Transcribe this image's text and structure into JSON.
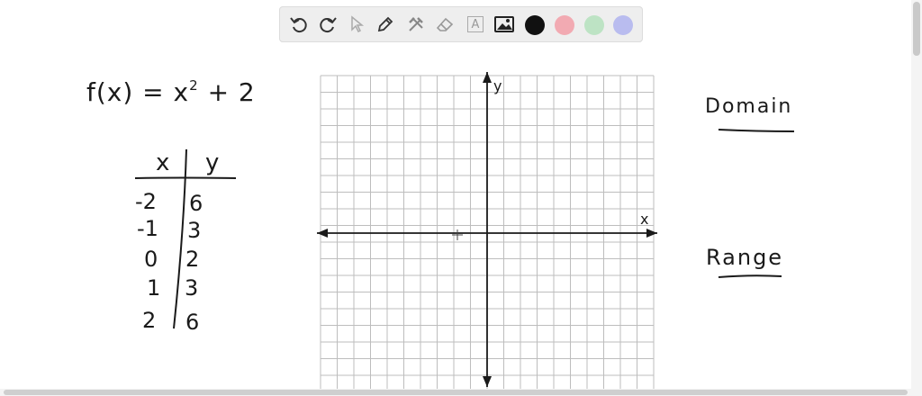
{
  "toolbar": {
    "tools": [
      {
        "name": "undo-icon"
      },
      {
        "name": "redo-icon"
      },
      {
        "name": "pointer-icon"
      },
      {
        "name": "pen-icon"
      },
      {
        "name": "tools-icon"
      },
      {
        "name": "eraser-icon"
      },
      {
        "name": "text-icon",
        "glyph": "A"
      },
      {
        "name": "image-icon"
      }
    ],
    "colors": [
      "#111111",
      "#f2aab2",
      "#bde3c4",
      "#b9bcef"
    ]
  },
  "whiteboard": {
    "function": {
      "lhs": "f(x) = x",
      "exponent": "2",
      "rhs": "+ 2"
    },
    "table": {
      "headers": [
        "x",
        "y"
      ],
      "rows": [
        [
          "-2",
          "6"
        ],
        [
          "-1",
          "3"
        ],
        [
          "0",
          "2"
        ],
        [
          "1",
          "3"
        ],
        [
          "2",
          "6"
        ]
      ]
    },
    "graph": {
      "x_label": "x",
      "y_label": "y"
    },
    "domain_label": "Domain",
    "range_label": "Range"
  }
}
